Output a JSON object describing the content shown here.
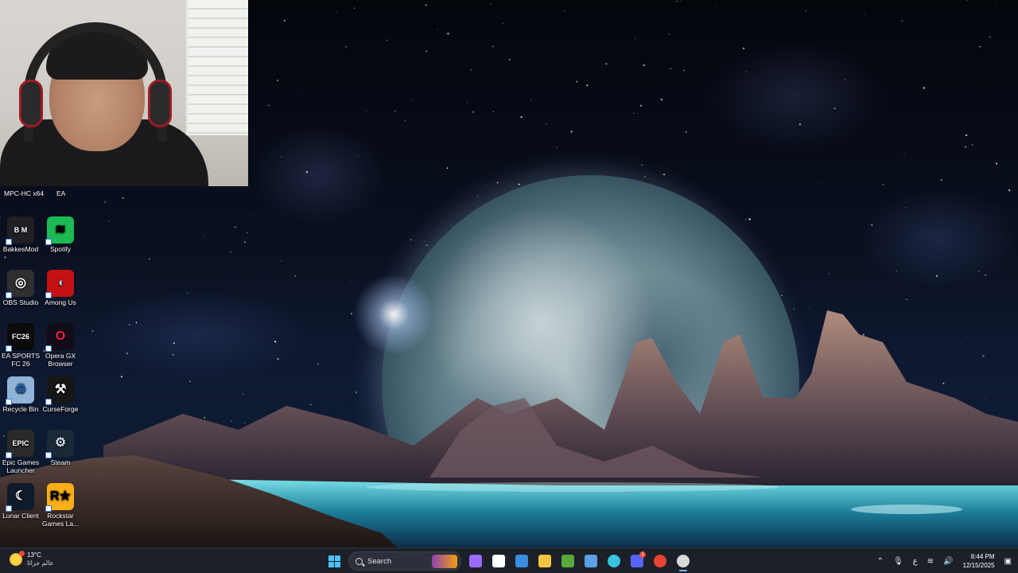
{
  "desktop": {
    "partial_icons": [
      "MPC-HC x64",
      "EA"
    ],
    "icons": [
      {
        "label": "BakkesMod",
        "icon": "bakkesmod-icon",
        "glyph": "B M",
        "bg": "#1f1f24",
        "fg": "#ffffff"
      },
      {
        "label": "Spotify",
        "icon": "spotify-icon",
        "glyph": "≋",
        "bg": "#1db954",
        "fg": "#000000"
      },
      {
        "label": "OBS Studio",
        "icon": "obs-icon",
        "glyph": "◎",
        "bg": "#302e31",
        "fg": "#ffffff"
      },
      {
        "label": "Among Us",
        "icon": "among-us-icon",
        "glyph": "◖",
        "bg": "#c51111",
        "fg": "#9bd3e8"
      },
      {
        "label": "EA SPORTS FC 26",
        "icon": "ea-fc26-icon",
        "glyph": "FC26",
        "bg": "#0a0a0a",
        "fg": "#ffffff"
      },
      {
        "label": "Opera GX Browser",
        "icon": "opera-gx-icon",
        "glyph": "O",
        "bg": "#120c16",
        "fg": "#fa1e4e"
      },
      {
        "label": "Recycle Bin",
        "icon": "recycle-bin-icon",
        "glyph": "♻",
        "bg": "#8fb4d8",
        "fg": "#1d5fa8"
      },
      {
        "label": "CurseForge",
        "icon": "curseforge-icon",
        "glyph": "⚒",
        "bg": "#161616",
        "fg": "#ffffff"
      },
      {
        "label": "Epic Games Launcher",
        "icon": "epic-games-icon",
        "glyph": "EPIC",
        "bg": "#2a2a2a",
        "fg": "#ffffff"
      },
      {
        "label": "Steam",
        "icon": "steam-icon",
        "glyph": "⚙",
        "bg": "#1b2838",
        "fg": "#c7d5e0"
      },
      {
        "label": "Lunar Client",
        "icon": "lunar-client-icon",
        "glyph": "☾",
        "bg": "#0f1a2a",
        "fg": "#ffffff"
      },
      {
        "label": "Rockstar Games La...",
        "icon": "rockstar-icon",
        "glyph": "R★",
        "bg": "#fcaf17",
        "fg": "#000000"
      }
    ]
  },
  "taskbar": {
    "weather": {
      "temp": "13°C",
      "desc": "عالم جزائا",
      "icon": "weather-icon"
    },
    "search_label": "Search",
    "apps": [
      {
        "name": "copilot-icon",
        "color": "#9b6bff"
      },
      {
        "name": "store-icon",
        "color": "#ffffff"
      },
      {
        "name": "defender-icon",
        "color": "#3b8de0"
      },
      {
        "name": "file-explorer-icon",
        "color": "#f5c542"
      },
      {
        "name": "minecraft-icon",
        "color": "#58a83c"
      },
      {
        "name": "pen-tool-icon",
        "color": "#5aa0e6"
      },
      {
        "name": "edge-icon",
        "color": "#36c3e0"
      },
      {
        "name": "discord-icon",
        "color": "#5865f2",
        "badge": "1"
      },
      {
        "name": "chrome-icon",
        "color": "#ea4335"
      },
      {
        "name": "obs-taskbar-icon",
        "color": "#d9d9d9",
        "active": true
      }
    ],
    "tray": {
      "lang": "ع",
      "time": "8:44 PM",
      "date": "12/15/2025"
    }
  }
}
